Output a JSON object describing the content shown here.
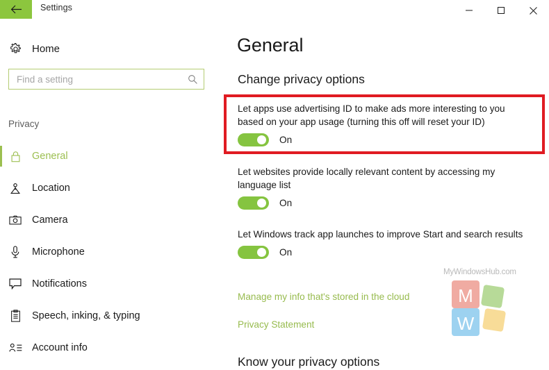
{
  "window": {
    "title": "Settings",
    "back_icon": "back-arrow-icon",
    "minimize_icon": "minimize-icon",
    "maximize_icon": "maximize-icon",
    "close_icon": "close-icon"
  },
  "sidebar": {
    "home": {
      "label": "Home",
      "icon": "gear-icon"
    },
    "search": {
      "value": "",
      "placeholder": "Find a setting",
      "icon": "search-icon"
    },
    "section_label": "Privacy",
    "items": [
      {
        "label": "General",
        "icon": "lock-icon",
        "selected": true
      },
      {
        "label": "Location",
        "icon": "location-pin-icon",
        "selected": false
      },
      {
        "label": "Camera",
        "icon": "camera-icon",
        "selected": false
      },
      {
        "label": "Microphone",
        "icon": "microphone-icon",
        "selected": false
      },
      {
        "label": "Notifications",
        "icon": "speech-bubble-icon",
        "selected": false
      },
      {
        "label": "Speech, inking, & typing",
        "icon": "clipboard-icon",
        "selected": false
      },
      {
        "label": "Account info",
        "icon": "account-info-icon",
        "selected": false
      }
    ]
  },
  "main": {
    "title": "General",
    "subheading": "Change privacy options",
    "settings": [
      {
        "description": "Let apps use advertising ID to make ads more interesting to you based on your app usage (turning this off will reset your ID)",
        "toggle_state": "On",
        "highlighted": true
      },
      {
        "description": "Let websites provide locally relevant content by accessing my language list",
        "toggle_state": "On",
        "highlighted": false
      },
      {
        "description": "Let Windows track app launches to improve Start and search results",
        "toggle_state": "On",
        "highlighted": false
      }
    ],
    "links": [
      "Manage my info that's stored in the cloud",
      "Privacy Statement"
    ],
    "bottom_heading": "Know your privacy options"
  },
  "watermark": {
    "text": "MyWindowsHub.com",
    "letter_m": "M",
    "letter_w": "W"
  },
  "colors": {
    "accent_green": "#8cc63e",
    "toggle_green": "#85c440",
    "link_green": "#97bb4e",
    "highlight_red": "#e01b22",
    "search_border": "#b4cc72"
  }
}
